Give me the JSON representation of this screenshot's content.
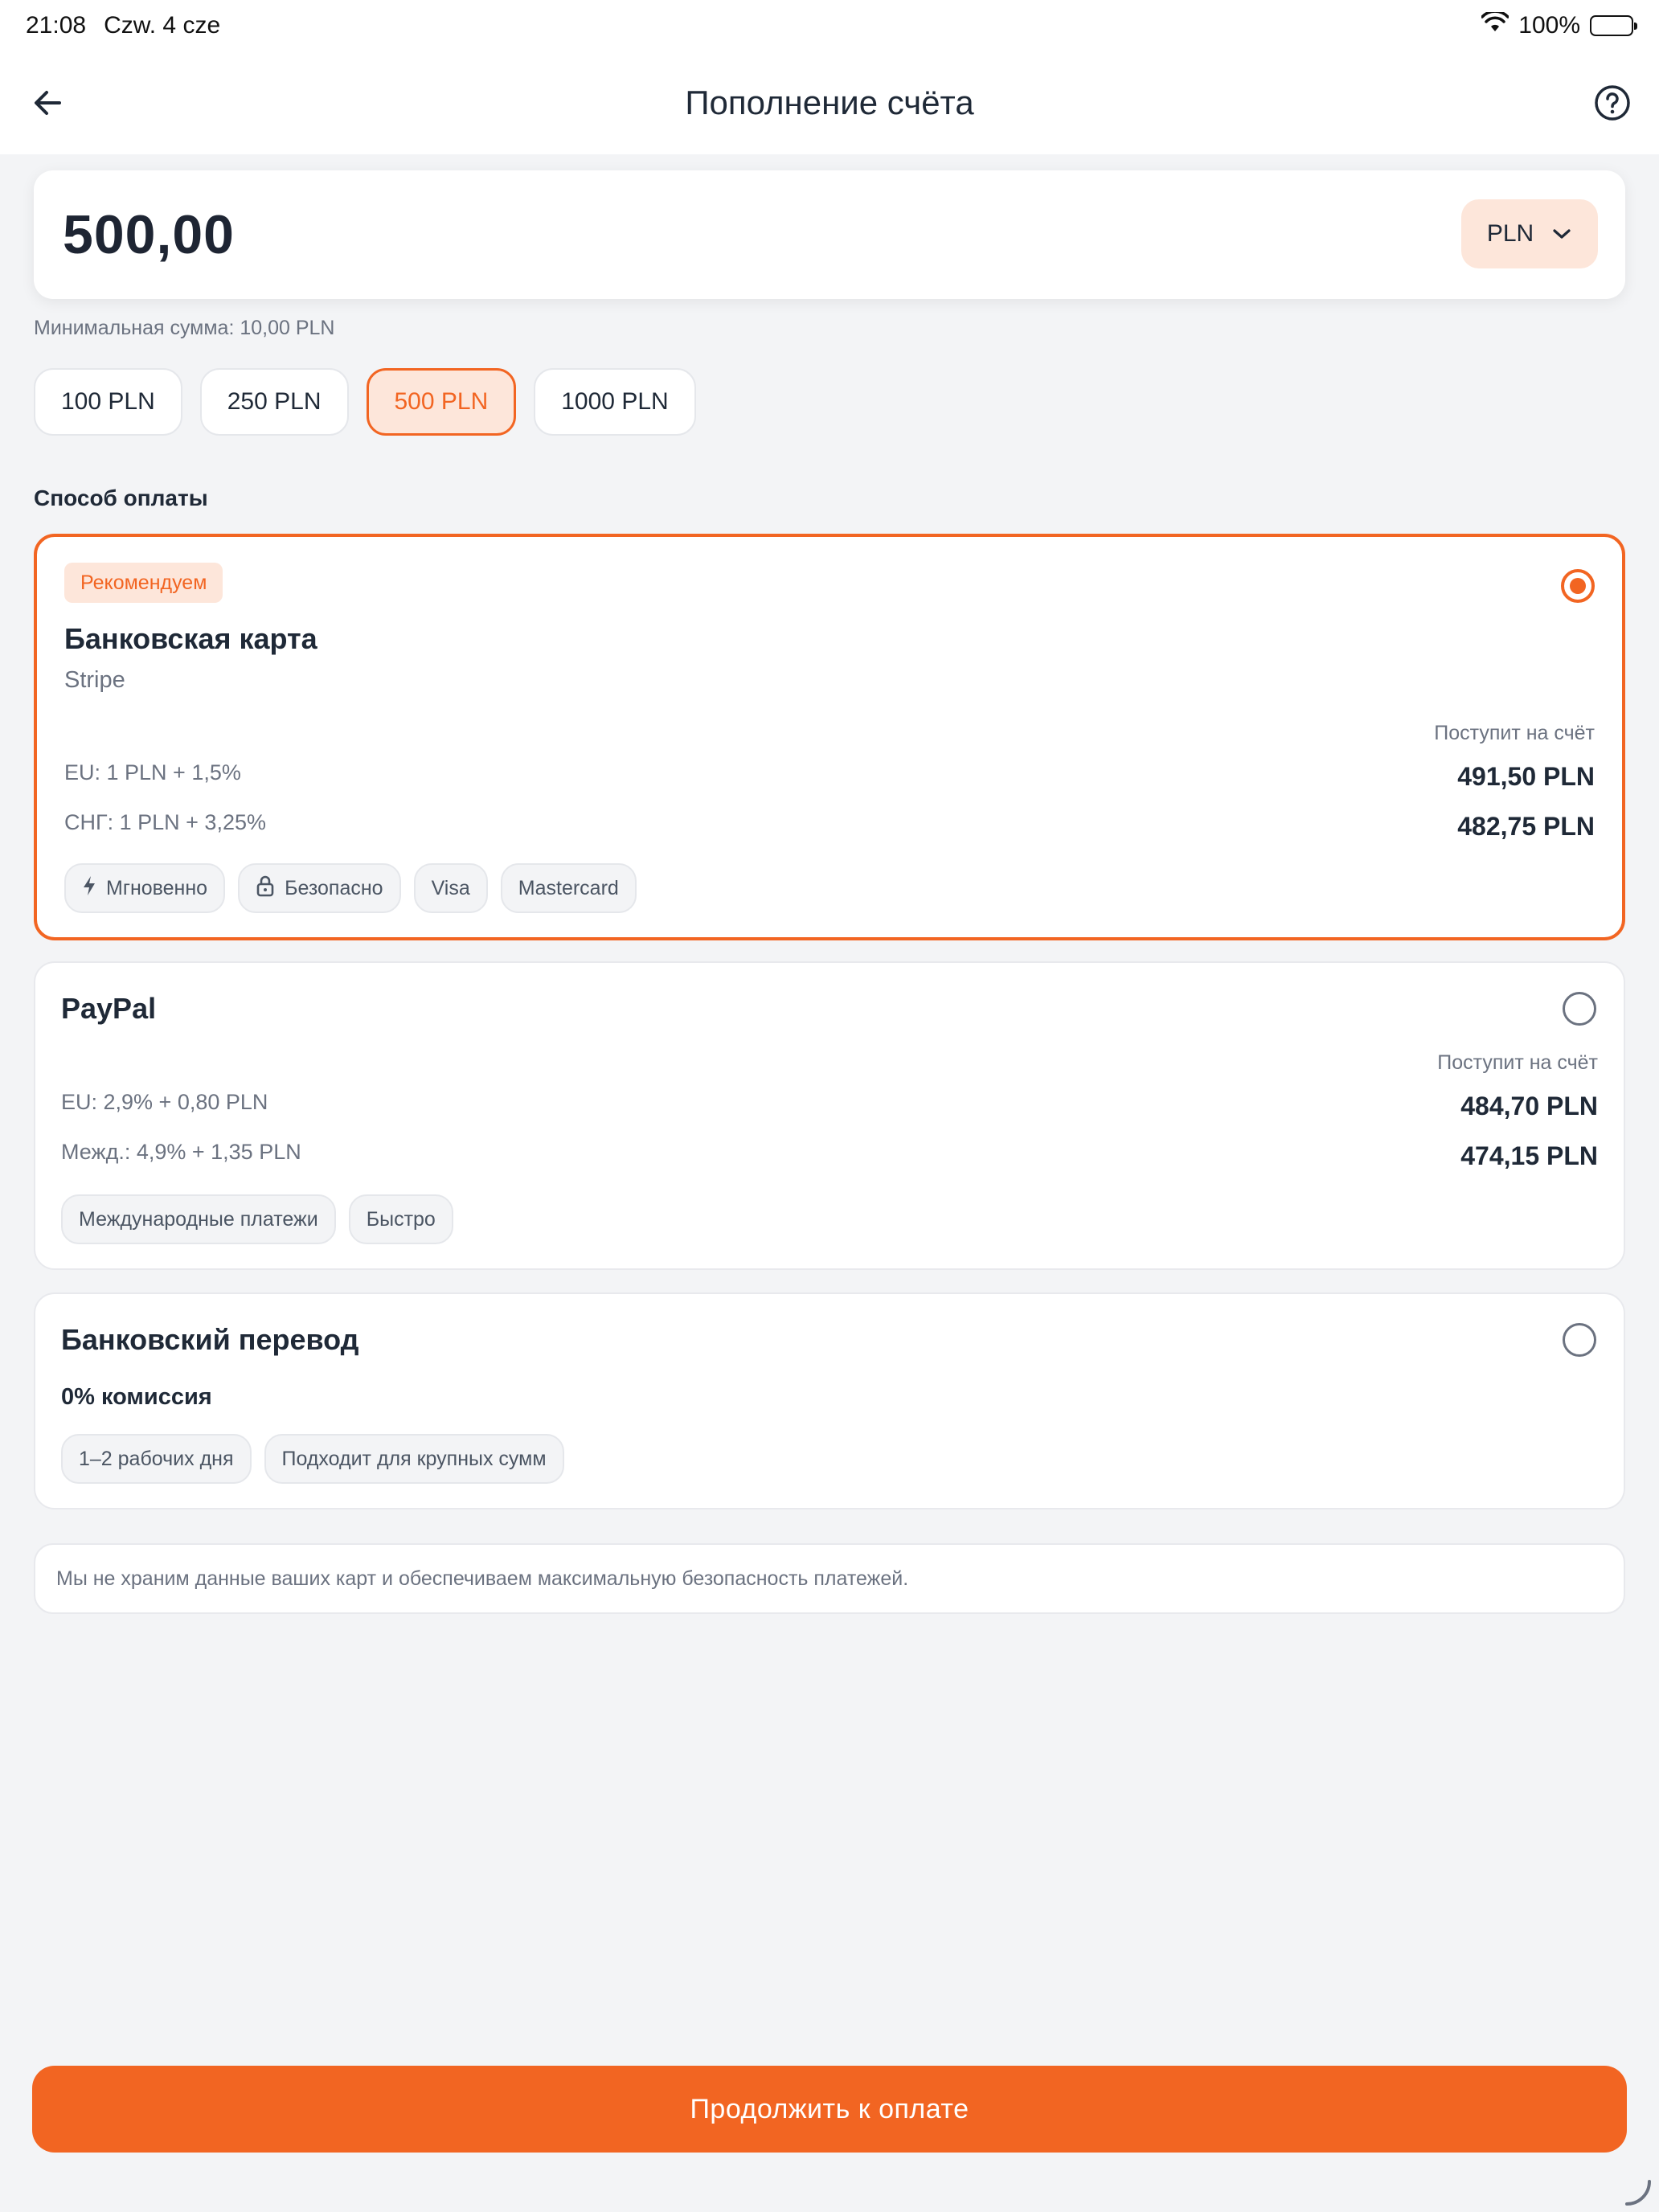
{
  "status_bar": {
    "time": "21:08",
    "date": "Czw. 4 cze",
    "battery": "100%"
  },
  "header": {
    "title": "Пополнение счёта",
    "back_icon": "arrow-left-icon",
    "help_icon": "question-circle-icon"
  },
  "amount": {
    "value": "500,00",
    "currency": "PLN",
    "min_label": "Минимальная сумма: 10,00 PLN"
  },
  "quick_amounts": [
    {
      "label": "100 PLN",
      "selected": false
    },
    {
      "label": "250 PLN",
      "selected": false
    },
    {
      "label": "500 PLN",
      "selected": true
    },
    {
      "label": "1000 PLN",
      "selected": false
    }
  ],
  "payment_section": {
    "title": "Способ оплаты",
    "methods": [
      {
        "badge": "Рекомендуем",
        "title": "Банковская карта",
        "provider": "Stripe",
        "receive_label": "Поступит на счёт",
        "fees": [
          "EU: 1 PLN + 1,5%",
          "СНГ: 1 PLN + 3,25%"
        ],
        "receive": [
          "491,50 PLN",
          "482,75 PLN"
        ],
        "tags": [
          "Мгновенно",
          "Безопасно",
          "Visa",
          "Mastercard"
        ],
        "selected": true
      },
      {
        "title": "PayPal",
        "receive_label": "Поступит на счёт",
        "fees": [
          "EU: 2,9% + 0,80 PLN",
          "Межд.: 4,9% + 1,35 PLN"
        ],
        "receive": [
          "484,70 PLN",
          "474,15 PLN"
        ],
        "tags": [
          "Международные платежи",
          "Быстро"
        ],
        "selected": false
      },
      {
        "title": "Банковский перевод",
        "commission": "0% комиссия",
        "tags": [
          "1–2 рабочих дня",
          "Подходит для крупных сумм"
        ],
        "selected": false
      }
    ]
  },
  "security_note": "Мы не храним данные ваших карт и обеспечиваем максимальную безопасность платежей.",
  "continue_button": "Продолжить к оплате",
  "colors": {
    "accent": "#f26522",
    "accent_light": "#fde6da",
    "background": "#f3f4f6"
  }
}
